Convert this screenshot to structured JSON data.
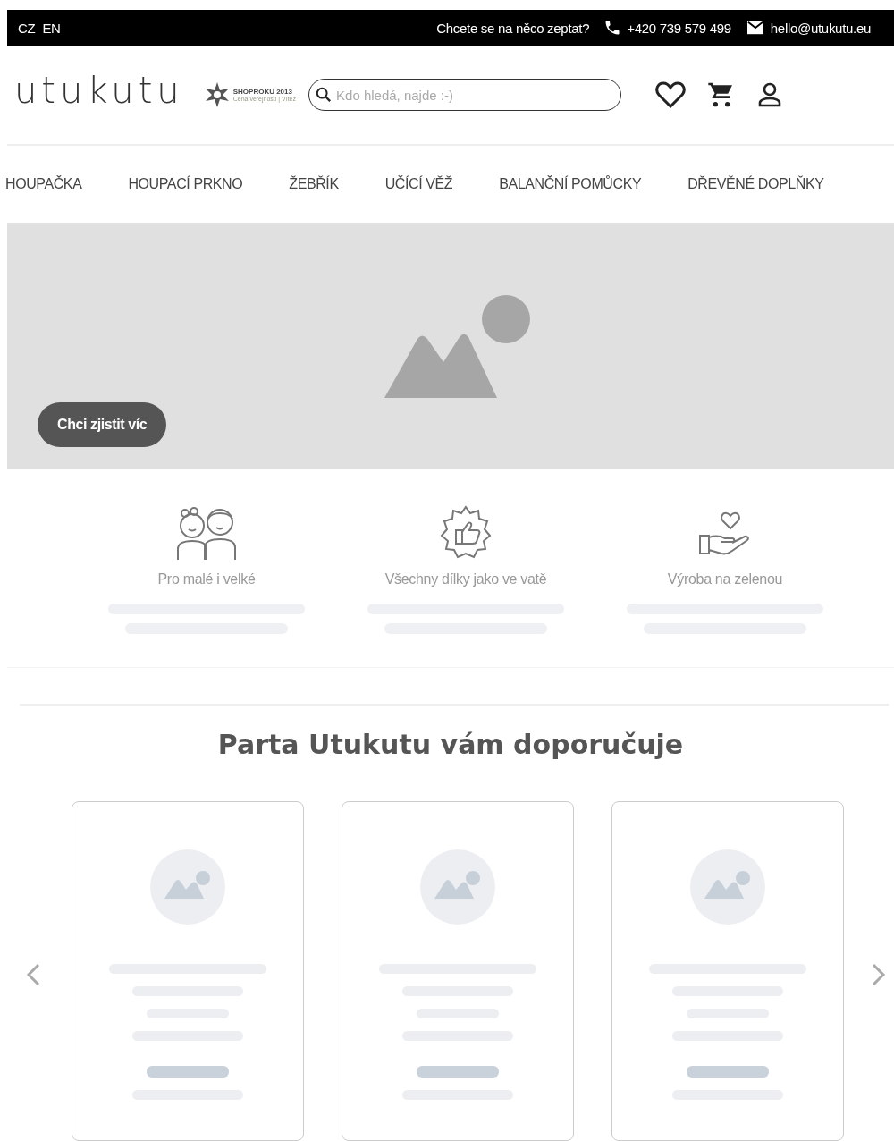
{
  "top_bar": {
    "languages": [
      {
        "label": "CZ"
      },
      {
        "label": "EN"
      }
    ],
    "question": "Chcete se na něco zeptat?",
    "phone": "+420 739 579 499",
    "email": "hello@utukutu.eu"
  },
  "header": {
    "logo": "utukutu",
    "award": {
      "title": "SHOPROKU 2013",
      "subtitle": "Cena veřejnosti | Vítěz"
    },
    "search": {
      "placeholder": "Kdo hledá, najde :-)"
    }
  },
  "nav": [
    {
      "label": "HOUPAČKA"
    },
    {
      "label": "HOUPACÍ PRKNO"
    },
    {
      "label": "ŽEBŘÍK"
    },
    {
      "label": "UČÍCÍ VĚŽ"
    },
    {
      "label": "BALANČNÍ POMŮCKY"
    },
    {
      "label": "DŘEVĚNÉ DOPLŇKY"
    }
  ],
  "hero": {
    "button": "Chci zjistit víc"
  },
  "features": [
    {
      "kind": "kids",
      "title": "Pro malé i velké"
    },
    {
      "kind": "badge",
      "title": "Všechny dílky jako ve vatě"
    },
    {
      "kind": "hand",
      "title": "Výroba na zelenou"
    }
  ],
  "recommend": {
    "title": "Parta Utukutu vám doporučuje",
    "cards": [
      {
        "kind": "placeholder"
      },
      {
        "kind": "placeholder"
      },
      {
        "kind": "placeholder"
      }
    ]
  }
}
